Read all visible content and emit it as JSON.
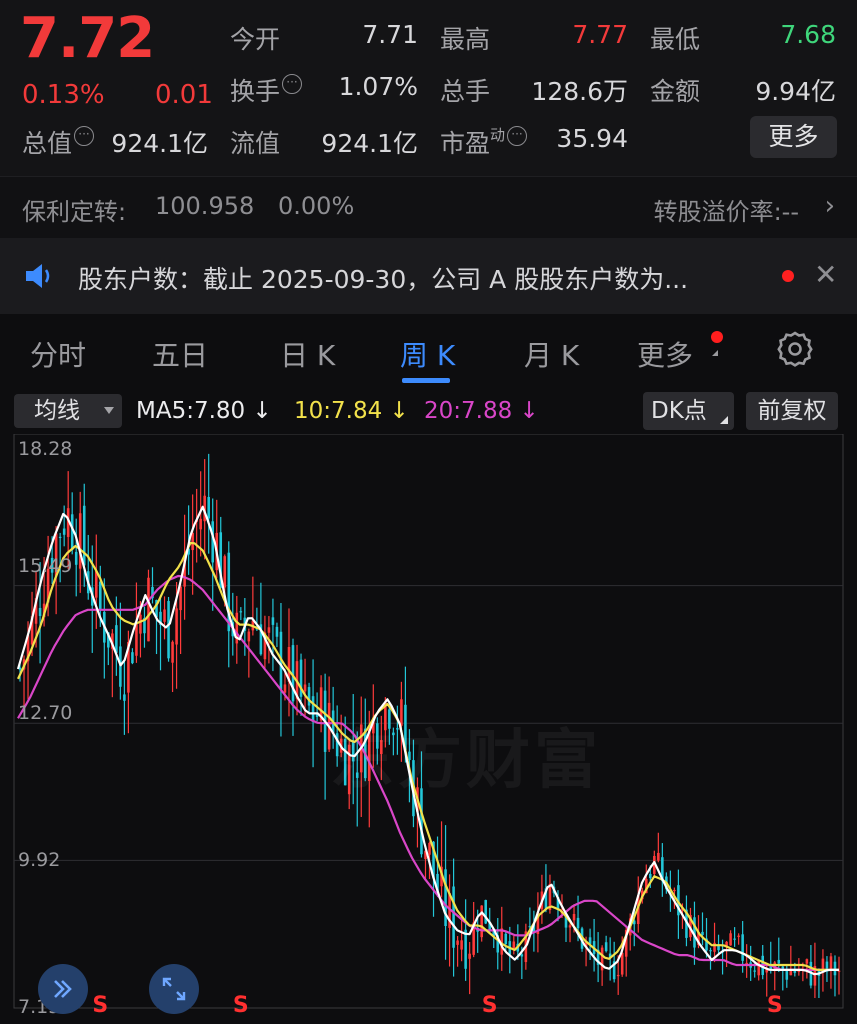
{
  "quote": {
    "price": "7.72",
    "change_pct": "0.13%",
    "change": "0.01",
    "open_label": "今开",
    "open": "7.71",
    "high_label": "最高",
    "high": "7.77",
    "low_label": "最低",
    "low": "7.68",
    "turnover_label": "换手",
    "turnover": "1.07%",
    "volume_label": "总手",
    "volume": "128.6万",
    "amount_label": "金额",
    "amount": "9.94亿",
    "mcap_label": "总值",
    "mcap": "924.1亿",
    "float_label": "流值",
    "float": "924.1亿",
    "pe_label": "市盈",
    "pe_sup": "动",
    "pe": "35.94",
    "more_label": "更多",
    "colors": {
      "up": "#f23a3a",
      "down": "#3fd67b"
    }
  },
  "bond": {
    "name": "保利定转:",
    "price": "100.958",
    "pct": "0.00%",
    "premium": "转股溢价率:--"
  },
  "notice": {
    "text": "股东户数：截止 2025-09-30，公司 A 股股东户数为...",
    "close_icon": "close-icon"
  },
  "tabs": [
    {
      "label": "分时"
    },
    {
      "label": "五日"
    },
    {
      "label": "日 K"
    },
    {
      "label": "周 K",
      "active": true
    },
    {
      "label": "月 K"
    },
    {
      "label": "更多"
    }
  ],
  "indicators": {
    "ma_select": "均线",
    "ma5": "MA5:7.80 ↓",
    "ma10": "10:7.84 ↓",
    "ma20": "20:7.88 ↓",
    "dk": "DK点",
    "adjust": "前复权"
  },
  "chart_data": {
    "type": "candlestick",
    "ylim": [
      7.13,
      18.28
    ],
    "y_ticks": [
      "18.28",
      "15.49",
      "12.70",
      "9.92",
      "7.13"
    ],
    "ma_colors": {
      "ma5": "#ffffff",
      "ma10": "#f2e14b",
      "ma20": "#d946c8"
    },
    "candle_colors": {
      "up": "#ff3b3b",
      "down": "#23c7d9"
    },
    "ma5": [
      13.8,
      14.6,
      15.6,
      16.4,
      17.0,
      16.5,
      15.6,
      14.9,
      14.4,
      13.8,
      14.6,
      15.3,
      14.8,
      14.6,
      15.5,
      16.6,
      17.1,
      16.4,
      15.1,
      14.3,
      14.9,
      14.6,
      14.1,
      13.8,
      13.3,
      12.9,
      12.9,
      12.6,
      12.2,
      12.0,
      12.3,
      12.9,
      13.2,
      12.7,
      11.5,
      10.4,
      9.5,
      8.8,
      8.5,
      8.4,
      8.9,
      8.6,
      8.1,
      7.9,
      8.2,
      8.9,
      9.5,
      9.0,
      8.6,
      8.2,
      7.9,
      7.7,
      7.9,
      8.7,
      9.5,
      9.9,
      9.4,
      9.0,
      8.6,
      8.2,
      7.9,
      8.1,
      8.1,
      8.0,
      7.8,
      7.7,
      7.7,
      7.7,
      7.7,
      7.6,
      7.7,
      7.7
    ],
    "ma10": [
      13.6,
      14.1,
      14.7,
      15.5,
      16.1,
      16.3,
      16.1,
      15.7,
      15.1,
      14.8,
      14.7,
      14.8,
      15.1,
      15.6,
      15.9,
      16.4,
      16.2,
      15.7,
      15.1,
      14.7,
      14.7,
      14.6,
      14.3,
      13.9,
      13.6,
      13.2,
      13.0,
      12.8,
      12.5,
      12.3,
      12.5,
      12.9,
      13.1,
      12.7,
      11.6,
      10.8,
      10.1,
      9.4,
      8.9,
      8.6,
      8.6,
      8.4,
      8.2,
      8.1,
      8.4,
      8.8,
      9.0,
      8.9,
      8.6,
      8.3,
      8.1,
      7.9,
      8.1,
      8.6,
      9.2,
      9.6,
      9.5,
      9.1,
      8.8,
      8.4,
      8.2,
      8.2,
      8.1,
      8.0,
      7.9,
      7.8,
      7.8,
      7.8,
      7.8,
      7.7,
      7.7,
      7.7
    ],
    "ma20": [
      12.8,
      13.2,
      13.7,
      14.2,
      14.6,
      14.9,
      15.0,
      15.0,
      15.0,
      15.0,
      15.0,
      15.1,
      15.4,
      15.6,
      15.7,
      15.6,
      15.4,
      15.1,
      14.8,
      14.5,
      14.2,
      13.9,
      13.6,
      13.3,
      13.0,
      12.8,
      12.7,
      12.7,
      12.7,
      12.5,
      12.1,
      11.6,
      11.1,
      10.5,
      10.0,
      9.6,
      9.3,
      9.0,
      8.8,
      8.6,
      8.5,
      8.5,
      8.5,
      8.4,
      8.4,
      8.5,
      8.6,
      8.8,
      9.0,
      9.1,
      9.1,
      8.9,
      8.7,
      8.5,
      8.3,
      8.2,
      8.1,
      8.0,
      8.0,
      7.9,
      7.9,
      7.9,
      7.8,
      7.8,
      7.8,
      7.8,
      7.7,
      7.7,
      7.7,
      7.7,
      7.7,
      7.7
    ],
    "signals": [
      {
        "label": "S",
        "index": 20
      },
      {
        "label": "S",
        "index": 55
      },
      {
        "label": "S",
        "index": 117
      },
      {
        "label": "S",
        "index": 188
      }
    ]
  },
  "watermark": "东方财富",
  "fab_icons": [
    "double-chevron-right-icon",
    "expand-arrows-icon"
  ]
}
